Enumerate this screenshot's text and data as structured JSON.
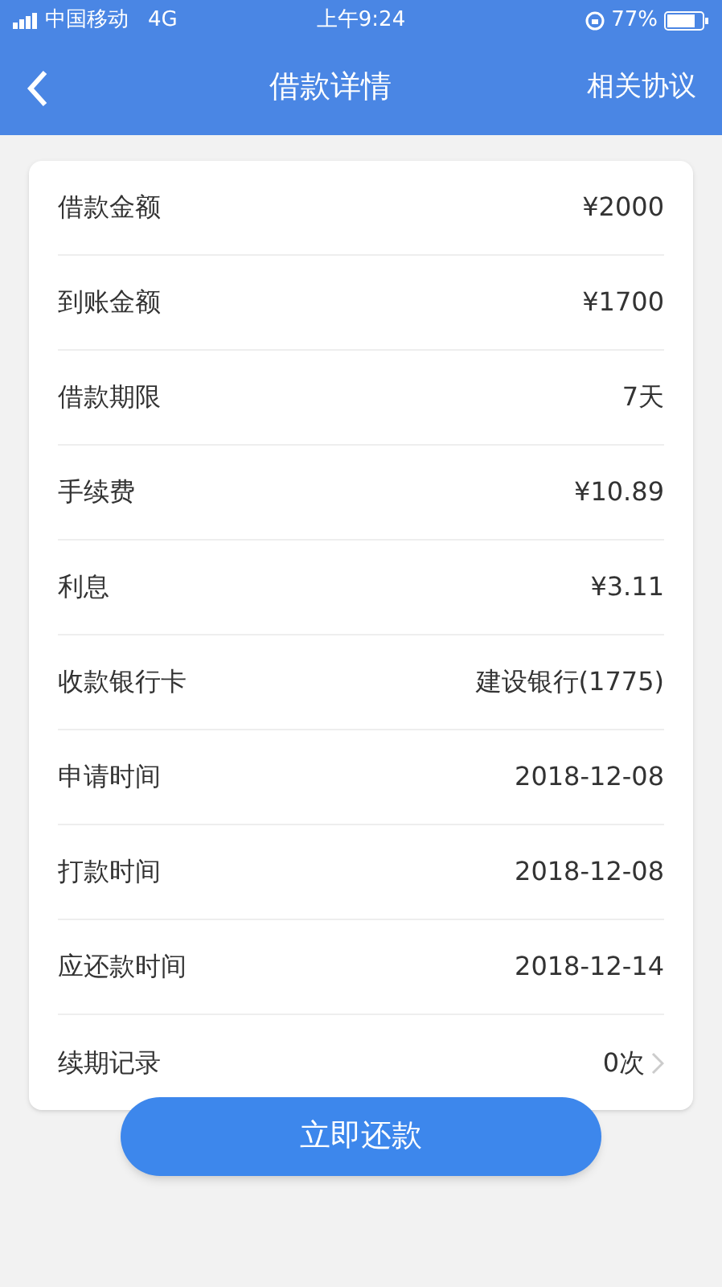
{
  "status_bar": {
    "carrier": "中国移动",
    "network": "4G",
    "time": "上午9:24",
    "battery": "77%"
  },
  "nav": {
    "title": "借款详情",
    "action": "相关协议"
  },
  "rows": [
    {
      "kind": "plain",
      "label": "借款金额",
      "value": "¥2000"
    },
    {
      "kind": "plain",
      "label": "到账金额",
      "value": "¥1700"
    },
    {
      "kind": "plain",
      "label": "借款期限",
      "value": "7天"
    },
    {
      "kind": "plain",
      "label": "手续费",
      "value": "¥10.89"
    },
    {
      "kind": "plain",
      "label": "利息",
      "value": "¥3.11"
    },
    {
      "kind": "plain",
      "label": "收款银行卡",
      "value": "建设银行(1775)"
    },
    {
      "kind": "plain",
      "label": "申请时间",
      "value": "2018-12-08"
    },
    {
      "kind": "plain",
      "label": "打款时间",
      "value": "2018-12-08"
    },
    {
      "kind": "plain",
      "label": "应还款时间",
      "value": "2018-12-14"
    },
    {
      "kind": "link",
      "label": "续期记录",
      "value": "0次"
    }
  ],
  "button": "立即还款"
}
